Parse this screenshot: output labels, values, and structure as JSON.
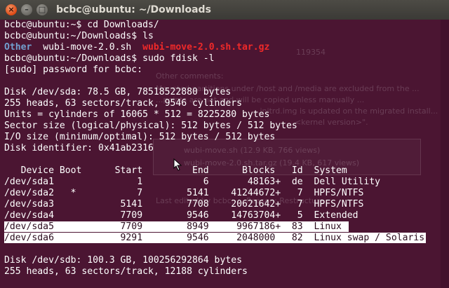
{
  "window": {
    "title": "bcbc@ubuntu: ~/Downloads"
  },
  "window_controls": {
    "close": "×",
    "minimize": "–",
    "maximize": "□"
  },
  "background_text": [
    "119354",
    "Other comments:",
    "Mounted partitions under /host and /media are excluded from the ...",
    "...points are not and will be copied unless manually ...",
    "...initrd.img is updated on the migrated install...",
    "<kernel version>\".",
    "wubi-move.sh (12.9 KB, 766 views)",
    "wubi-move-2.0.sh.tar.gz (19.4 KB, 617 views)",
    "Last edited by bcbc; ... Reason: Restructure"
  ],
  "terminal": {
    "lines": [
      [
        {
          "t": "bcbc@ubuntu:~$ cd Downloads/"
        }
      ],
      [
        {
          "t": "bcbc@ubuntu:~/Downloads$ ls"
        }
      ],
      [
        {
          "t": "Other",
          "c": "blue"
        },
        {
          "t": "  wubi-move-2.0.sh  "
        },
        {
          "t": "wubi-move-2.0.sh.tar.gz",
          "c": "red"
        }
      ],
      [
        {
          "t": "bcbc@ubuntu:~/Downloads$ sudo fdisk -l"
        }
      ],
      [
        {
          "t": "[sudo] password for bcbc:"
        }
      ],
      [
        {
          "t": ""
        }
      ],
      [
        {
          "t": "Disk /dev/sda: 78.5 GB, 78518522880 bytes"
        }
      ],
      [
        {
          "t": "255 heads, 63 sectors/track, 9546 cylinders"
        }
      ],
      [
        {
          "t": "Units = cylinders of 16065 * 512 = 8225280 bytes"
        }
      ],
      [
        {
          "t": "Sector size (logical/physical): 512 bytes / 512 bytes"
        }
      ],
      [
        {
          "t": "I/O size (minimum/optimal): 512 bytes / 512 bytes"
        }
      ],
      [
        {
          "t": "Disk identifier: 0x41ab2316"
        }
      ],
      [
        {
          "t": ""
        }
      ],
      [
        {
          "t": "   Device Boot      Start         End      Blocks   Id  System"
        }
      ],
      [
        {
          "t": "/dev/sda1               1           6       48163+  de  Dell Utility"
        }
      ],
      [
        {
          "t": "/dev/sda2   *           7        5141    41244672+   7  HPFS/NTFS"
        }
      ],
      [
        {
          "t": "/dev/sda3            5141        7708    20621642+   7  HPFS/NTFS"
        }
      ],
      [
        {
          "t": "/dev/sda4            7709        9546    14763704+   5  Extended"
        }
      ],
      [
        {
          "t": "/dev/sda5            7709        8949     9967186+  83  Linux ",
          "c": "hl"
        }
      ],
      [
        {
          "t": "/dev/sda6            9291        9546     2048000   82  Linux swap / Solaris",
          "c": "hl"
        }
      ],
      [
        {
          "t": ""
        }
      ],
      [
        {
          "t": "Disk /dev/sdb: 100.3 GB, 100256292864 bytes"
        }
      ],
      [
        {
          "t": "255 heads, 63 sectors/track, 12188 cylinders"
        }
      ]
    ]
  },
  "colors": {
    "terminal_bg": "#4b1532",
    "directory": "#729fcf",
    "archive": "#ef2929",
    "highlight": "#ffffff"
  }
}
